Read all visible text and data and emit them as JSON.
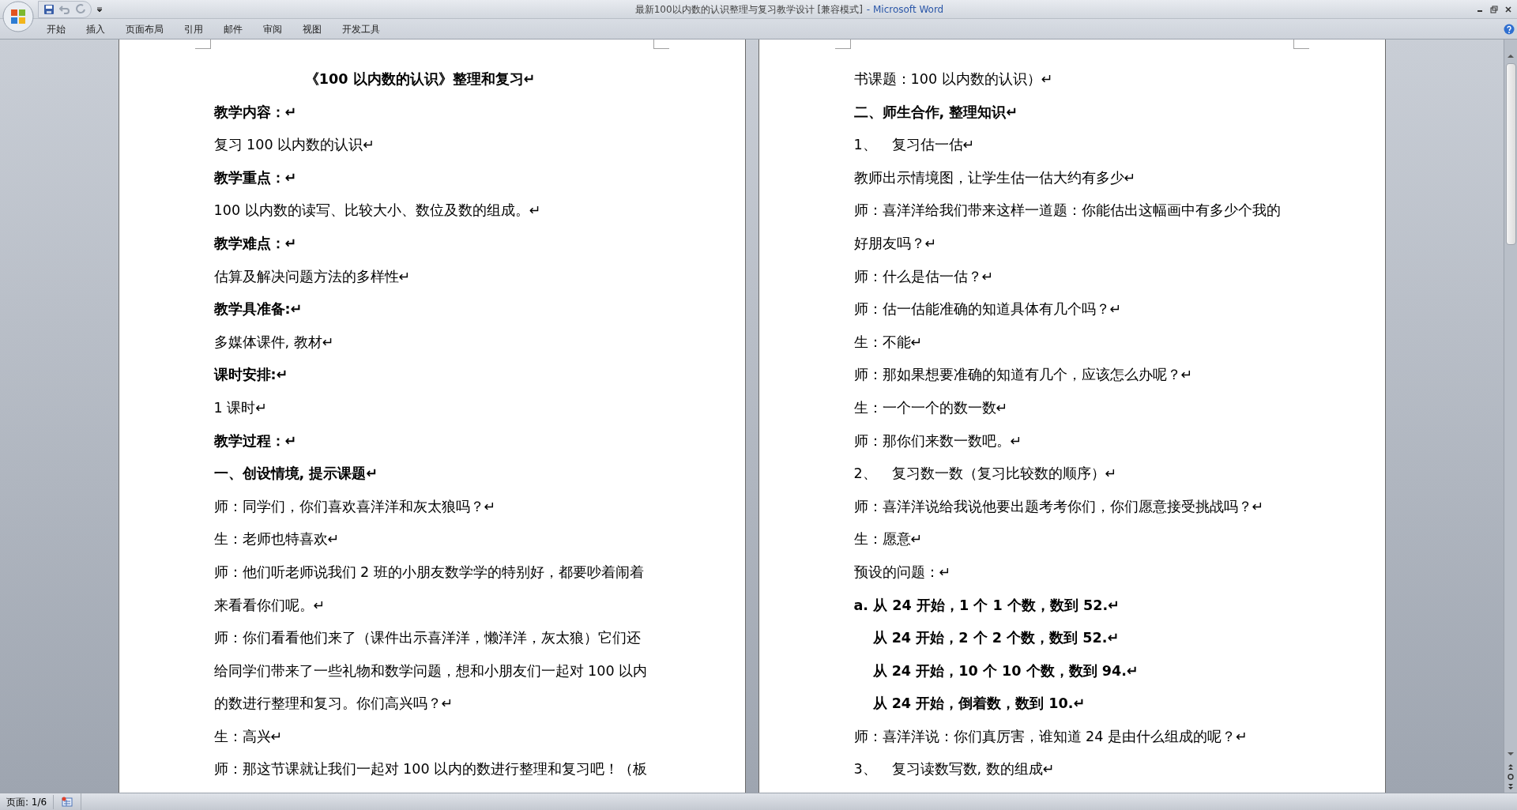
{
  "window": {
    "title": "最新100以内数的认识整理与复习教学设计 [兼容模式]",
    "app": "- Microsoft Word"
  },
  "ribbon_tabs": [
    {
      "label": "开始"
    },
    {
      "label": "插入"
    },
    {
      "label": "页面布局"
    },
    {
      "label": "引用"
    },
    {
      "label": "邮件"
    },
    {
      "label": "审阅"
    },
    {
      "label": "视图"
    },
    {
      "label": "开发工具"
    }
  ],
  "pages": [
    {
      "paragraphs": [
        {
          "kind": "title",
          "lines": [
            "《100 以内数的认识》整理和复习↵"
          ]
        },
        {
          "kind": "bold",
          "lines": [
            "教学内容：↵"
          ]
        },
        {
          "kind": "body",
          "lines": [
            "复习 100 以内数的认识↵"
          ]
        },
        {
          "kind": "bold",
          "lines": [
            "教学重点：↵"
          ]
        },
        {
          "kind": "body",
          "lines": [
            "100 以内数的读写、比较大小、数位及数的组成。↵"
          ]
        },
        {
          "kind": "bold",
          "lines": [
            "教学难点：↵"
          ]
        },
        {
          "kind": "body",
          "lines": [
            "估算及解决问题方法的多样性↵"
          ]
        },
        {
          "kind": "bold",
          "lines": [
            "教学具准备:↵"
          ]
        },
        {
          "kind": "body",
          "lines": [
            "多媒体课件, 教材↵"
          ]
        },
        {
          "kind": "bold",
          "lines": [
            "课时安排:↵"
          ]
        },
        {
          "kind": "body",
          "lines": [
            "1 课时↵"
          ]
        },
        {
          "kind": "bold",
          "lines": [
            "教学过程：↵"
          ]
        },
        {
          "kind": "bold",
          "lines": [
            "一、创设情境, 提示课题↵"
          ]
        },
        {
          "kind": "body",
          "lines": [
            "师：同学们，你们喜欢喜洋洋和灰太狼吗？↵"
          ]
        },
        {
          "kind": "body",
          "lines": [
            "生：老师也特喜欢↵"
          ]
        },
        {
          "kind": "body",
          "lines": [
            "师：他们听老师说我们 2 班的小朋友数学学的特别好，都要吵着闹着",
            "来看看你们呢。↵"
          ]
        },
        {
          "kind": "body",
          "lines": [
            "师：你们看看他们来了（课件出示喜洋洋，懒洋洋，灰太狼）它们还",
            "给同学们带来了一些礼物和数学问题，想和小朋友们一起对 100 以内",
            "的数进行整理和复习。你们高兴吗？↵"
          ]
        },
        {
          "kind": "body",
          "lines": [
            "生：高兴↵"
          ]
        },
        {
          "kind": "body",
          "lines": [
            "师：那这节课就让我们一起对 100 以内的数进行整理和复习吧！（板"
          ]
        }
      ]
    },
    {
      "paragraphs": [
        {
          "kind": "body",
          "lines": [
            "书课题：100 以内数的认识）↵"
          ]
        },
        {
          "kind": "bold",
          "lines": [
            "二、师生合作, 整理知识↵"
          ]
        },
        {
          "kind": "numbered",
          "number": "1、",
          "lines": [
            "复习估一估↵"
          ]
        },
        {
          "kind": "body",
          "lines": [
            "教师出示情境图，让学生估一估大约有多少↵"
          ]
        },
        {
          "kind": "body",
          "lines": [
            "师：喜洋洋给我们带来这样一道题：你能估出这幅画中有多少个我的",
            "好朋友吗？↵"
          ]
        },
        {
          "kind": "body",
          "lines": [
            "师：什么是估一估？↵"
          ]
        },
        {
          "kind": "body",
          "lines": [
            "师：估一估能准确的知道具体有几个吗？↵"
          ]
        },
        {
          "kind": "body",
          "lines": [
            "生：不能↵"
          ]
        },
        {
          "kind": "body",
          "lines": [
            "师：那如果想要准确的知道有几个，应该怎么办呢？↵"
          ]
        },
        {
          "kind": "body",
          "lines": [
            "生：一个一个的数一数↵"
          ]
        },
        {
          "kind": "body",
          "lines": [
            "师：那你们来数一数吧。↵"
          ]
        },
        {
          "kind": "numbered",
          "number": "2、",
          "lines": [
            "复习数一数（复习比较数的顺序）↵"
          ]
        },
        {
          "kind": "body",
          "lines": [
            "师：喜洋洋说给我说他要出题考考你们，你们愿意接受挑战吗？↵"
          ]
        },
        {
          "kind": "body",
          "lines": [
            "生：愿意↵"
          ]
        },
        {
          "kind": "body",
          "lines": [
            "预设的问题：↵"
          ]
        },
        {
          "kind": "bold",
          "lines": [
            "a. 从 24 开始，1 个 1 个数，数到 52.↵"
          ]
        },
        {
          "kind": "indented_bold",
          "lines": [
            "从 24 开始，2 个 2 个数，数到 52.↵"
          ]
        },
        {
          "kind": "indented_bold",
          "lines": [
            "从 24 开始，10 个 10 个数，数到 94.↵"
          ]
        },
        {
          "kind": "indented_bold",
          "lines": [
            "从 24 开始，倒着数，数到 10.↵"
          ]
        },
        {
          "kind": "body",
          "lines": [
            "师：喜洋洋说：你们真厉害，谁知道 24 是由什么组成的呢？↵"
          ]
        },
        {
          "kind": "numbered",
          "number": "3、",
          "lines": [
            "复习读数写数, 数的组成↵"
          ]
        }
      ]
    }
  ],
  "status_bar": {
    "page": "页面: 1/6"
  }
}
